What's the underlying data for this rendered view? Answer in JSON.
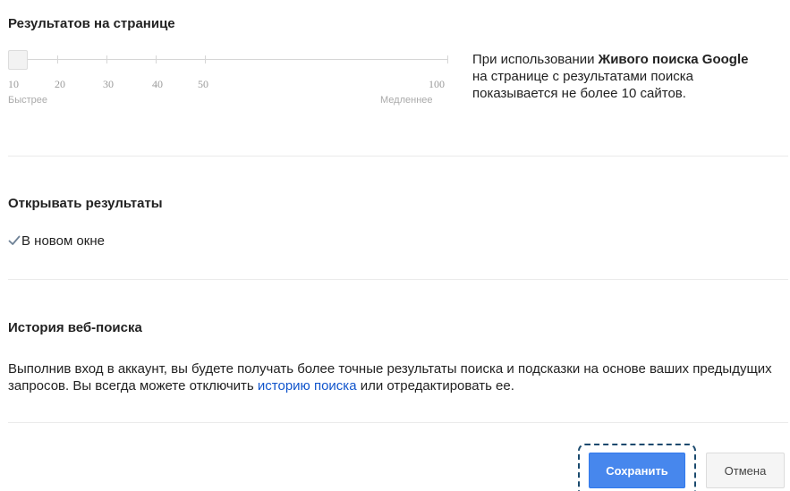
{
  "results_per_page": {
    "title": "Результатов на странице",
    "slider": {
      "selected_value": 10,
      "labels": [
        "10",
        "20",
        "30",
        "40",
        "50",
        "100"
      ],
      "faster_label": "Быстрее",
      "slower_label": "Медленнее"
    },
    "info_pre": "При использовании ",
    "info_bold": "Живого поиска Google",
    "info_post": " на странице с результатами поиска показывается не более 10 сайтов."
  },
  "open_results": {
    "title": "Открывать результаты",
    "checkbox_label": "В новом окне",
    "checked": true
  },
  "web_history": {
    "title": "История веб-поиска",
    "text_pre": "Выполнив вход в аккаунт, вы будете получать более точные результаты поиска и подсказки на основе ваших предыдущих запросов. Вы всегда можете отключить ",
    "link_text": "историю поиска",
    "text_post": " или отредактировать ее."
  },
  "buttons": {
    "save_label": "Сохранить",
    "cancel_label": "Отмена"
  },
  "colors": {
    "accent": "#4787ed",
    "link": "#1155cc",
    "focus_ring": "#1a4a6e"
  }
}
